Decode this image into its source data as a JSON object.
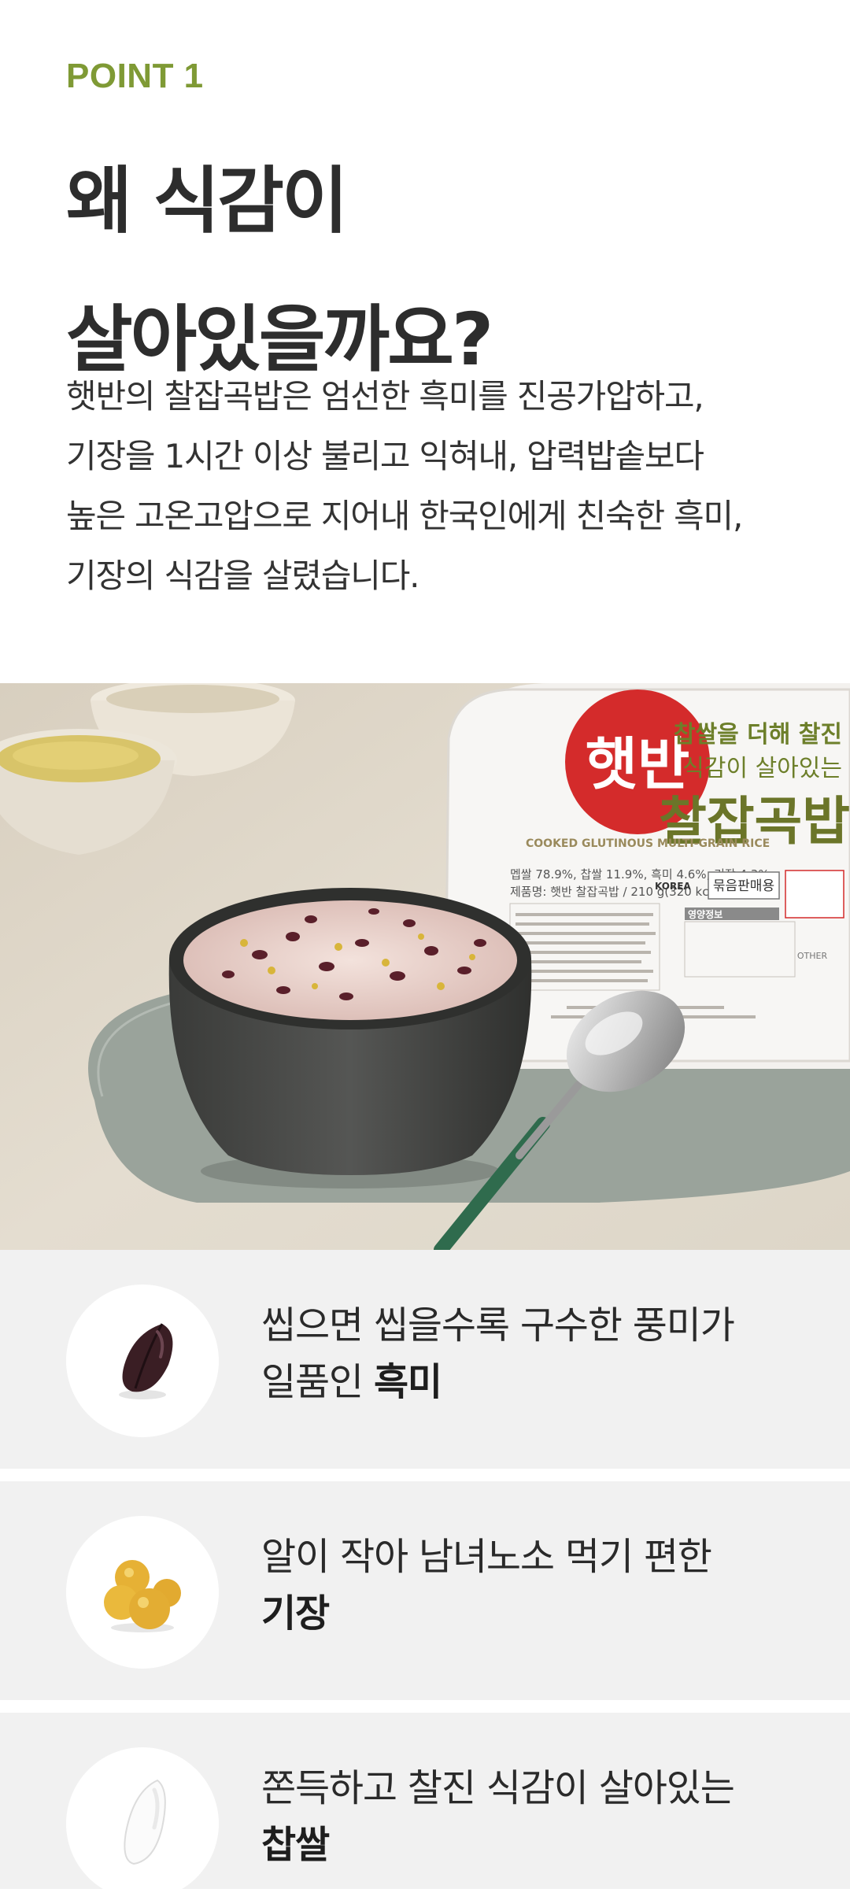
{
  "header": {
    "point_label": "POINT 1",
    "title_line1": "왜 식감이",
    "title_line2": "살아있을까요?"
  },
  "description": {
    "lines": [
      "햇반의 찰잡곡밥은 엄선한 흑미를 진공가압하고,",
      "기장을 1시간 이상 불리고 익혀내, 압력밥솥보다",
      "높은 고온고압으로 지어내 한국인에게 친숙한 흑미,",
      "기장의 식감을 살렸습니다."
    ]
  },
  "product": {
    "brand": "햇반",
    "tagline1": "찹쌀을 더해 찰진",
    "tagline2": "식감이 살아있는",
    "name": "찰잡곡밥",
    "english": "COOKED GLUTINOUS MULTI-GRAIN RICE",
    "composition": "멥쌀 78.9%, 찹쌀 11.9%, 흑미 4.6%, 기장 4.3%",
    "weight": "제품명: 햇반 찰잡곡밥 / 210 g(320 kcal)",
    "bundle_label": "묶음판매용",
    "korea_label": "KOREA",
    "nutrition_label": "영양정보",
    "recycle_label": "OTHER"
  },
  "features": [
    {
      "line1": "씹으면 씹을수록 구수한 풍미가",
      "prefix": "일품인 ",
      "bold": "흑미",
      "icon": "black-rice-icon"
    },
    {
      "line1": "알이 작아 남녀노소 먹기 편한",
      "prefix": "",
      "bold": "기장",
      "icon": "millet-icon"
    },
    {
      "line1": "쫀득하고 찰진 식감이 살아있는",
      "prefix": "",
      "bold": "찹쌀",
      "icon": "glutinous-rice-icon"
    }
  ],
  "colors": {
    "accent": "#7f9a35",
    "brand_red": "#d42b2b",
    "card_bg": "#f1f1f1"
  }
}
